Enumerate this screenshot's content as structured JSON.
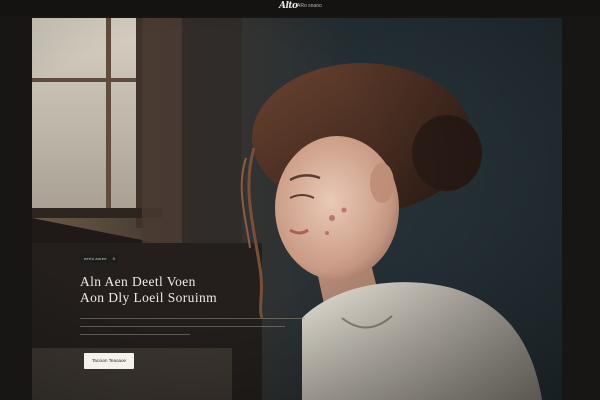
{
  "header": {
    "logo_text": "Alto",
    "nav_text": "ARo snaoo"
  },
  "hero": {
    "badge_label": "eerto aoree",
    "badge_sep": "5",
    "headline_line1": "Aln Aen Deetl Voen",
    "headline_line2": "Aon Dly Loeil Soruinm",
    "cta_label": "Tacoion Teaoaoe"
  },
  "colors": {
    "page_background": "#171614",
    "headline": "#efebe2",
    "button_background": "#f4f1ea"
  }
}
